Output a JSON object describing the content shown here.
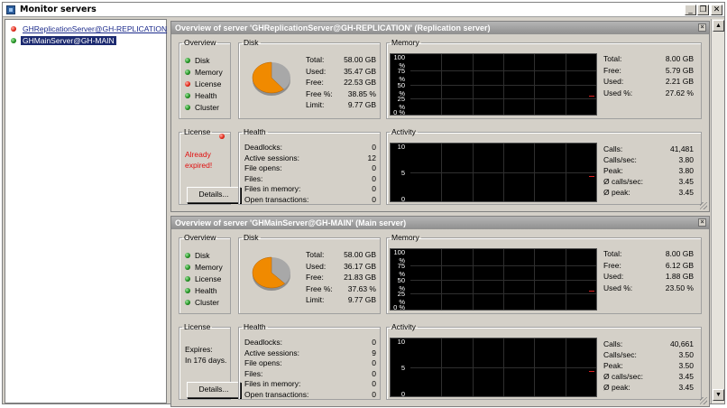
{
  "window": {
    "title": "Monitor servers"
  },
  "tree": {
    "items": [
      {
        "label": "GHReplicationServer@GH-REPLICATION",
        "status": "red"
      },
      {
        "label": "GHMainServer@GH-MAIN",
        "status": "green"
      }
    ]
  },
  "labels": {
    "overview": "Overview",
    "disk": "Disk",
    "memory": "Memory",
    "license": "License",
    "health": "Health",
    "activity": "Activity",
    "details_button": "Details..."
  },
  "panels": [
    {
      "title": "Overview of server 'GHReplicationServer@GH-REPLICATION' (Replication server)",
      "overview_items": [
        {
          "label": "Disk",
          "status": "green"
        },
        {
          "label": "Memory",
          "status": "green"
        },
        {
          "label": "License",
          "status": "red"
        },
        {
          "label": "Health",
          "status": "green"
        },
        {
          "label": "Cluster",
          "status": "green"
        }
      ],
      "disk": {
        "rows": [
          {
            "label": "Total:",
            "value": "58.00 GB"
          },
          {
            "label": "Used:",
            "value": "35.47 GB"
          },
          {
            "label": "Free:",
            "value": "22.53 GB"
          },
          {
            "label": "Free %:",
            "value": "38.85 %"
          },
          {
            "label": "Limit:",
            "value": "9.77 GB"
          }
        ],
        "used_fraction": 0.6115
      },
      "memory": {
        "axis": [
          "100 %",
          "75 %",
          "50 %",
          "25 %",
          "0 %"
        ],
        "rows": [
          {
            "label": "Total:",
            "value": "8.00 GB"
          },
          {
            "label": "Free:",
            "value": "5.79 GB"
          },
          {
            "label": "Used:",
            "value": "2.21 GB"
          },
          {
            "label": "Used %:",
            "value": "27.62 %"
          }
        ]
      },
      "license": {
        "status_lines": [
          "Already",
          "expired!"
        ],
        "expired": true
      },
      "health": {
        "rows": [
          {
            "label": "Deadlocks:",
            "value": "0"
          },
          {
            "label": "Active sessions:",
            "value": "12"
          },
          {
            "label": "File opens:",
            "value": "0"
          },
          {
            "label": "Files:",
            "value": "0"
          },
          {
            "label": "Files in memory:",
            "value": "0"
          },
          {
            "label": "Open transactions:",
            "value": "0"
          }
        ]
      },
      "activity": {
        "axis": [
          "10",
          "5",
          "0"
        ],
        "rows": [
          {
            "label": "Calls:",
            "value": "41,481"
          },
          {
            "label": "Calls/sec:",
            "value": "3.80"
          },
          {
            "label": "Peak:",
            "value": "3.80"
          },
          {
            "label": "Ø calls/sec:",
            "value": "3.45"
          },
          {
            "label": "Ø peak:",
            "value": "3.45"
          }
        ]
      }
    },
    {
      "title": "Overview of server 'GHMainServer@GH-MAIN' (Main server)",
      "overview_items": [
        {
          "label": "Disk",
          "status": "green"
        },
        {
          "label": "Memory",
          "status": "green"
        },
        {
          "label": "License",
          "status": "green"
        },
        {
          "label": "Health",
          "status": "green"
        },
        {
          "label": "Cluster",
          "status": "green"
        }
      ],
      "disk": {
        "rows": [
          {
            "label": "Total:",
            "value": "58.00 GB"
          },
          {
            "label": "Used:",
            "value": "36.17 GB"
          },
          {
            "label": "Free:",
            "value": "21.83 GB"
          },
          {
            "label": "Free %:",
            "value": "37.63 %"
          },
          {
            "label": "Limit:",
            "value": "9.77 GB"
          }
        ],
        "used_fraction": 0.6236
      },
      "memory": {
        "axis": [
          "100 %",
          "75 %",
          "50 %",
          "25 %",
          "0 %"
        ],
        "rows": [
          {
            "label": "Total:",
            "value": "8.00 GB"
          },
          {
            "label": "Free:",
            "value": "6.12 GB"
          },
          {
            "label": "Used:",
            "value": "1.88 GB"
          },
          {
            "label": "Used %:",
            "value": "23.50 %"
          }
        ]
      },
      "license": {
        "status_lines": [
          "Expires:",
          "In 176 days."
        ],
        "expired": false
      },
      "health": {
        "rows": [
          {
            "label": "Deadlocks:",
            "value": "0"
          },
          {
            "label": "Active sessions:",
            "value": "9"
          },
          {
            "label": "File opens:",
            "value": "0"
          },
          {
            "label": "Files:",
            "value": "0"
          },
          {
            "label": "Files in memory:",
            "value": "0"
          },
          {
            "label": "Open transactions:",
            "value": "0"
          }
        ]
      },
      "activity": {
        "axis": [
          "10",
          "5",
          "0"
        ],
        "rows": [
          {
            "label": "Calls:",
            "value": "40,661"
          },
          {
            "label": "Calls/sec:",
            "value": "3.50"
          },
          {
            "label": "Peak:",
            "value": "3.50"
          },
          {
            "label": "Ø calls/sec:",
            "value": "3.45"
          },
          {
            "label": "Ø peak:",
            "value": "3.45"
          }
        ]
      }
    }
  ],
  "colors": {
    "status_green": "#1a8a1a",
    "status_red": "#e02010",
    "pie_used": "#f08a00",
    "pie_free": "#a8a8a8",
    "graph_trace": "#e02020",
    "selection": "#1c2a70"
  },
  "icons": [
    "app-icon",
    "minimize-icon",
    "restore-icon",
    "close-icon",
    "status-led-icon",
    "disk-pie-icon",
    "scroll-up-icon",
    "scroll-down-icon"
  ]
}
